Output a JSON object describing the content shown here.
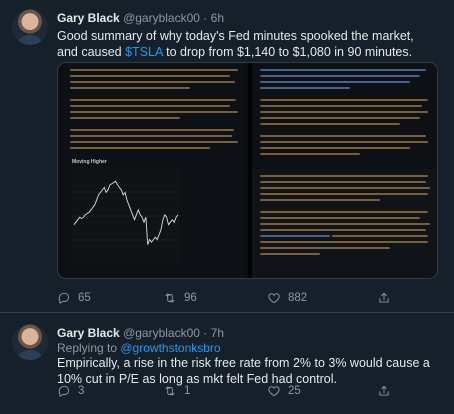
{
  "tweets": [
    {
      "author_name": "Gary Black",
      "handle": "@garyblack00",
      "separator": "·",
      "time": "6h",
      "text_before": "Good summary of why today's Fed minutes spooked the market, and caused ",
      "cashtag": "$TSLA",
      "text_after": " to drop from $1,140 to $1,080 in 90 minutes.",
      "media": {
        "chart_title": "Moving Higher",
        "chart_data": {
          "type": "line",
          "title": "Moving Higher",
          "series": [
            {
              "values": [
                1.3,
                1.4,
                1.5,
                1.6,
                1.55,
                1.6,
                1.7,
                1.75,
                1.8,
                1.9,
                2.0,
                2.1,
                2.3,
                2.5,
                2.6,
                2.7,
                2.8,
                2.6,
                2.7,
                2.9,
                2.95,
                3.0,
                3.05,
                2.9,
                2.8,
                2.7,
                2.5,
                2.6,
                2.3,
                2.1,
                1.9,
                1.7,
                1.5,
                1.7,
                1.9,
                1.7,
                1.6,
                1.4,
                1.6,
                0.5,
                0.7,
                0.6,
                0.7,
                0.8,
                0.7,
                0.9,
                1.1,
                1.5,
                1.7,
                1.6,
                1.3,
                1.4,
                1.5,
                1.4,
                1.6,
                1.7
              ]
            }
          ]
        }
      },
      "replies": "65",
      "retweets": "96",
      "likes": "882"
    },
    {
      "author_name": "Gary Black",
      "handle": "@garyblack00",
      "separator": "·",
      "time": "7h",
      "replying_label": "Replying to ",
      "replying_to": "@growthstonksbro",
      "text": "Empirically, a rise in the risk free rate from 2% to 3% would cause a 10% cut in P/E as long as mkt felt Fed had control.",
      "replies": "3",
      "retweets": "1",
      "likes": "25"
    }
  ],
  "colors": {
    "background": "#15202b",
    "accent": "#1d9bf0",
    "muted": "#8b98a5",
    "text": "#e7e9ea"
  },
  "icons": [
    "reply-icon",
    "retweet-icon",
    "like-icon",
    "share-icon"
  ]
}
